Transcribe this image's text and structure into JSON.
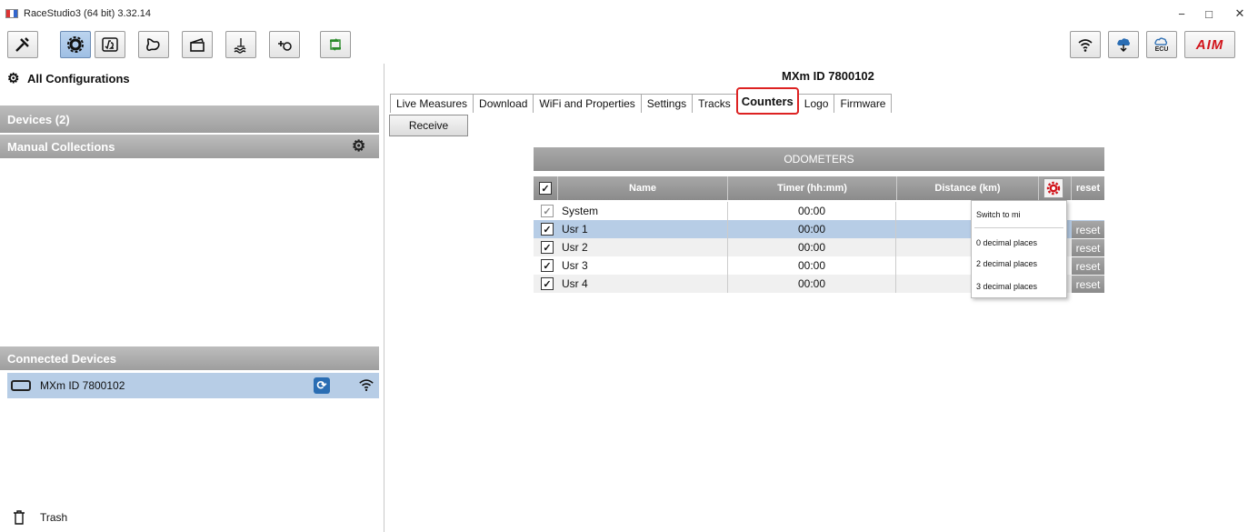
{
  "window": {
    "title": "RaceStudio3 (64 bit) 3.32.14",
    "minimize": "−",
    "maximize": "□",
    "close": "✕"
  },
  "toolbar": {
    "buttons": [
      "wrench-icon",
      "gear-icon",
      "math-channel-icon",
      "track-icon",
      "clapper-icon",
      "water-icon",
      "add-sensor-icon",
      "download-icon"
    ],
    "right_buttons": [
      "wifi-icon",
      "cloud-download-icon",
      "ecu-cloud-icon",
      "aim-logo"
    ],
    "ecu_label": "ECU",
    "logo_text": "AIM"
  },
  "sidebar": {
    "all_configurations": "All Configurations",
    "devices_header": "Devices (2)",
    "manual_collections_header": "Manual Collections",
    "connected_devices_header": "Connected Devices",
    "device_name": "MXm ID 7800102",
    "trash": "Trash"
  },
  "main": {
    "device_title": "MXm ID 7800102",
    "tabs": [
      "Live Measures",
      "Download",
      "WiFi and Properties",
      "Settings",
      "Tracks",
      "Counters",
      "Logo",
      "Firmware"
    ],
    "selected_tab": "Counters",
    "receive_button": "Receive",
    "odometers_header": "ODOMETERS",
    "columns": {
      "name": "Name",
      "timer": "Timer (hh:mm)",
      "distance": "Distance (km)",
      "reset": "reset"
    },
    "rows": [
      {
        "name": "System",
        "timer": "00:00",
        "checked": true,
        "reset": ""
      },
      {
        "name": "Usr 1",
        "timer": "00:00",
        "checked": true,
        "reset": "reset"
      },
      {
        "name": "Usr 2",
        "timer": "00:00",
        "checked": true,
        "reset": "reset"
      },
      {
        "name": "Usr 3",
        "timer": "00:00",
        "checked": true,
        "reset": "reset"
      },
      {
        "name": "Usr 4",
        "timer": "00:00",
        "checked": true,
        "reset": "reset"
      }
    ],
    "dropdown_menu": [
      "Switch to mi",
      "0 decimal places",
      "2 decimal places",
      "3 decimal places"
    ]
  },
  "colors": {
    "accent_selection": "#b7cde6",
    "header_gray": "#9e9e9e",
    "highlight_red": "#dd2222"
  }
}
